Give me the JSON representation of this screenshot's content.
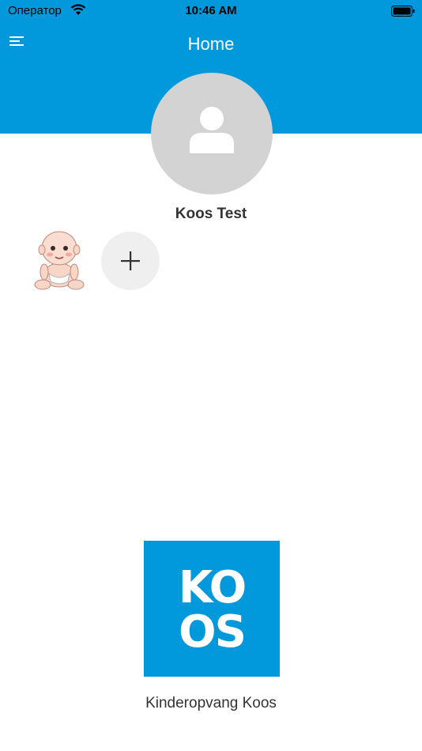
{
  "status_bar": {
    "carrier": "Оператор",
    "time": "10:46 AM"
  },
  "header": {
    "title": "Home",
    "background_color": "#0198DC"
  },
  "profile": {
    "name": "Koos Test",
    "avatar_icon": "person-icon"
  },
  "children": {
    "child_avatar": "baby-image",
    "add_icon": "plus-icon"
  },
  "logo": {
    "line1": "KO",
    "line2": "OS"
  },
  "footer": {
    "company_name": "Kinderopvang Koos"
  }
}
